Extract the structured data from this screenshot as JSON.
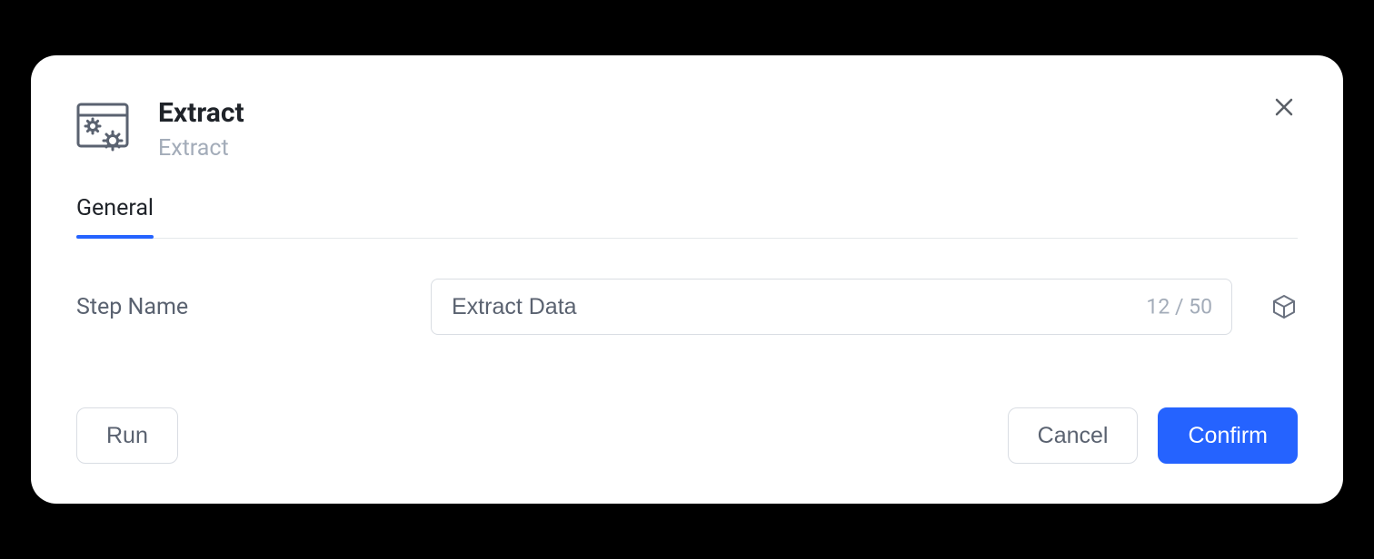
{
  "header": {
    "title": "Extract",
    "subtitle": "Extract"
  },
  "tabs": [
    {
      "label": "General",
      "active": true
    }
  ],
  "form": {
    "stepName_label": "Step Name",
    "stepName_value": "Extract Data",
    "stepName_charcount": "12 / 50"
  },
  "buttons": {
    "run": "Run",
    "cancel": "Cancel",
    "confirm": "Confirm"
  }
}
